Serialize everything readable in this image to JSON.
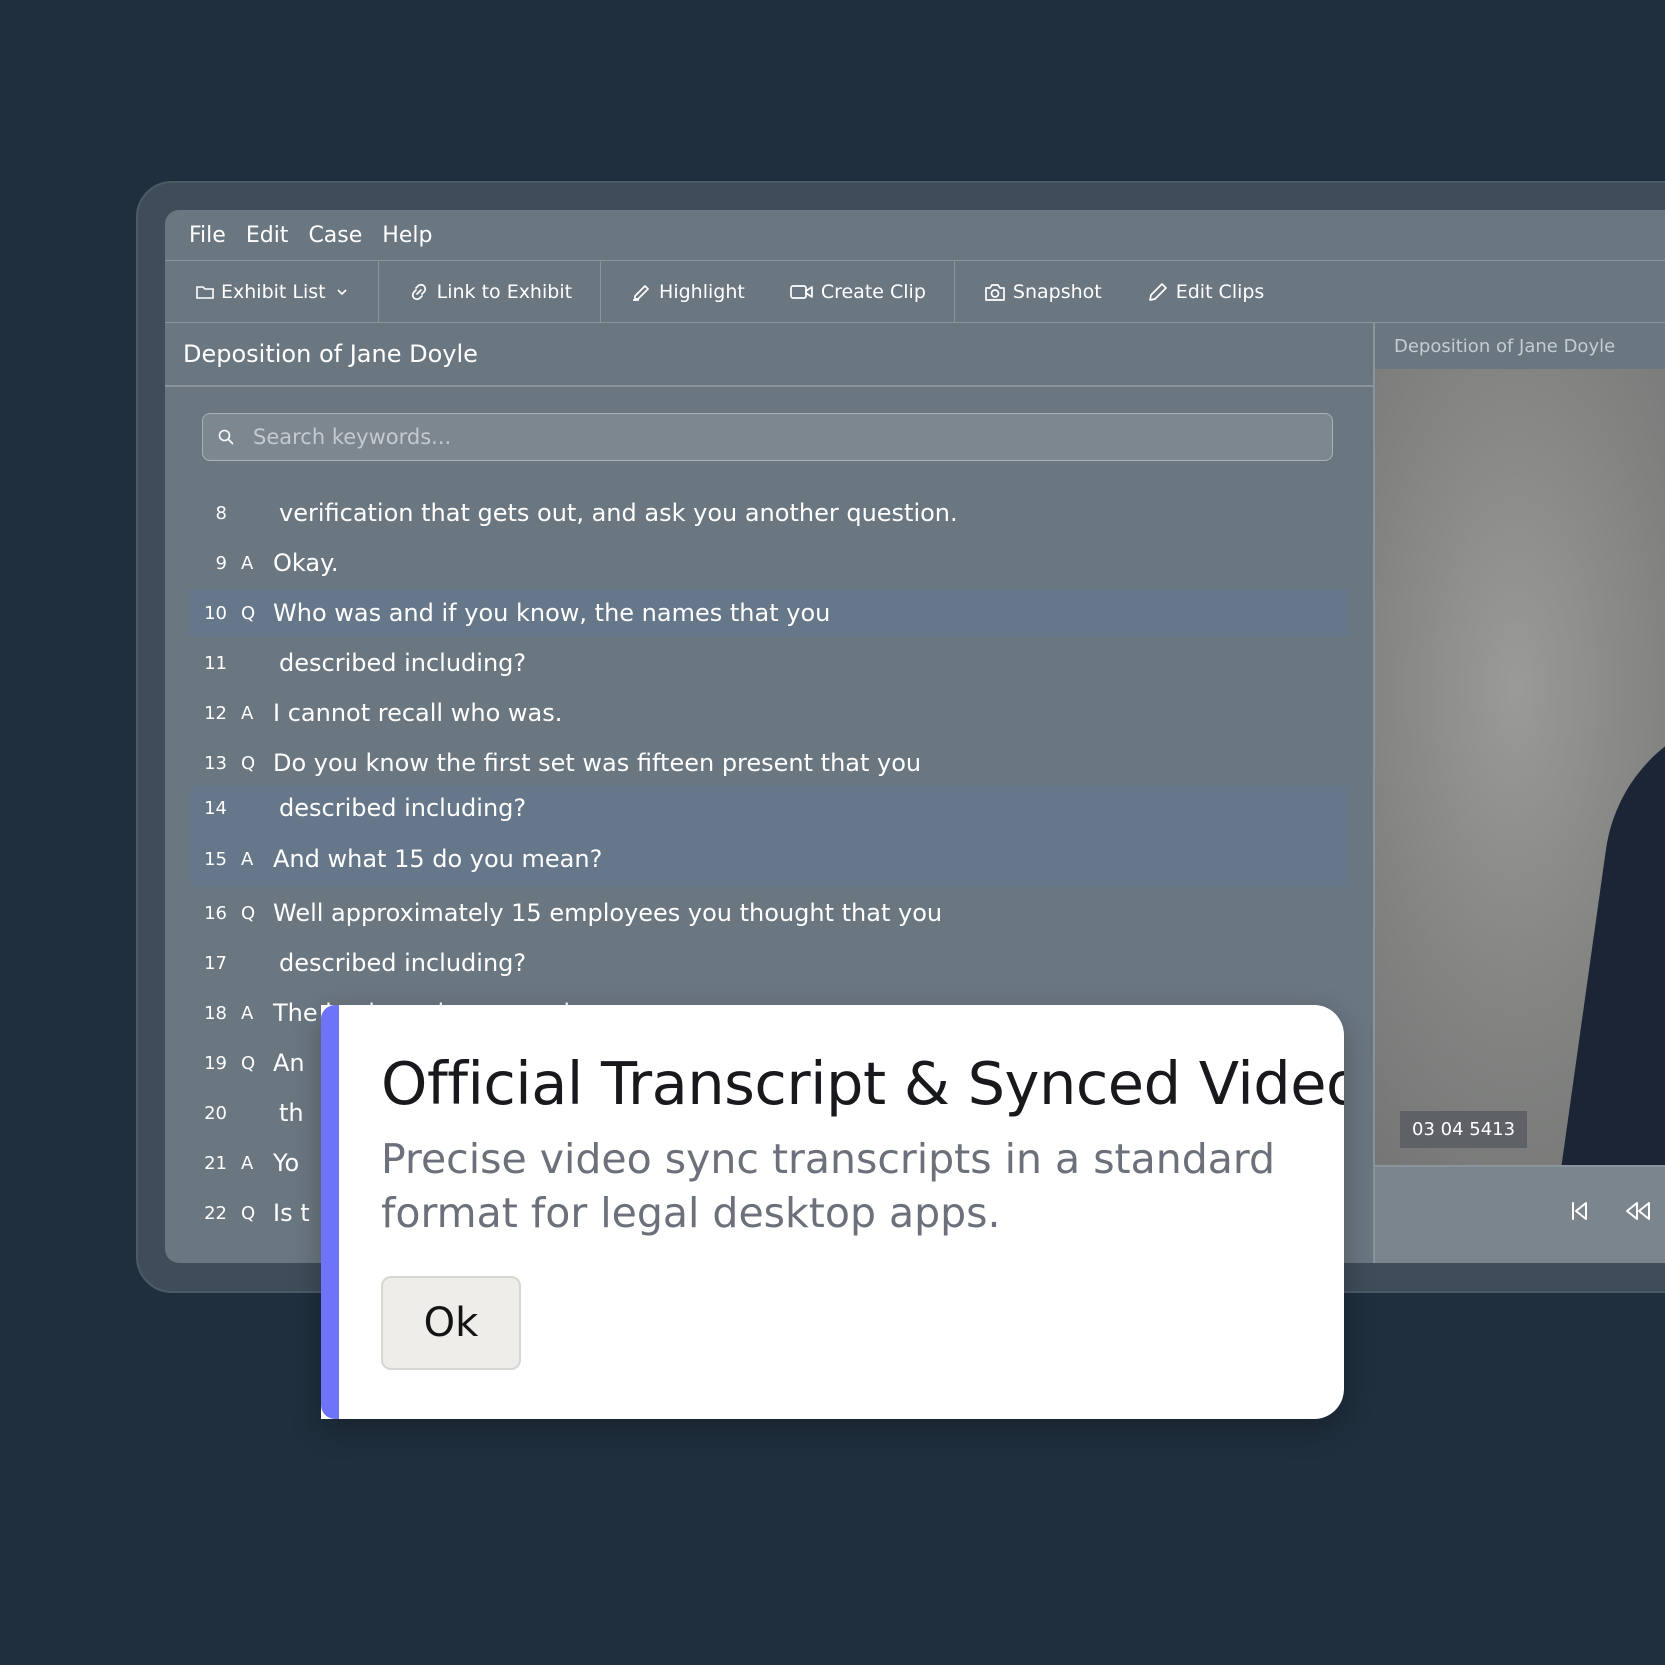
{
  "menu": [
    "File",
    "Edit",
    "Case",
    "Help"
  ],
  "toolbar": {
    "exhibit_list": "Exhibit List",
    "link_to_exhibit": "Link to Exhibit",
    "highlight": "Highlight",
    "create_clip": "Create Clip",
    "snapshot": "Snapshot",
    "edit_clips": "Edit Clips"
  },
  "transcript": {
    "title": "Deposition of Jane Doyle",
    "search_placeholder": "Search keywords...",
    "lines": [
      {
        "num": "8",
        "speaker": "",
        "text": "verification that gets out, and ask you another question.",
        "highlighted": false
      },
      {
        "num": "9",
        "speaker": "A",
        "text": "Okay.",
        "highlighted": false
      },
      {
        "num": "10",
        "speaker": "Q",
        "text": "Who was and if you know, the names that you",
        "highlighted": true
      },
      {
        "num": "11",
        "speaker": "",
        "text": "described including?",
        "highlighted": false
      },
      {
        "num": "12",
        "speaker": "A",
        "text": "I cannot recall who was.",
        "highlighted": false
      },
      {
        "num": "13",
        "speaker": "Q",
        "text": "Do you know the first set was fifteen present that you",
        "highlighted": false
      },
      {
        "num": "14",
        "speaker": "",
        "text": "described including?",
        "highlighted": true
      },
      {
        "num": "15",
        "speaker": "A",
        "text": "And what 15 do you mean?",
        "highlighted": true
      },
      {
        "num": "16",
        "speaker": "Q",
        "text": "Well approximately 15 employees you thought that you",
        "highlighted": false
      },
      {
        "num": "17",
        "speaker": "",
        "text": "described including?",
        "highlighted": false
      },
      {
        "num": "18",
        "speaker": "A",
        "text": "The business is seasonal",
        "highlighted": false
      },
      {
        "num": "19",
        "speaker": "Q",
        "text": "An",
        "highlighted": false
      },
      {
        "num": "20",
        "speaker": "",
        "text": "th",
        "highlighted": false
      },
      {
        "num": "21",
        "speaker": "A",
        "text": "Yo",
        "highlighted": false
      },
      {
        "num": "22",
        "speaker": "Q",
        "text": "Is t",
        "highlighted": false
      }
    ]
  },
  "video": {
    "title": "Deposition of Jane Doyle",
    "timecode": "03 04 5413"
  },
  "dialog": {
    "title": "Official Transcript & Synced Video",
    "body": "Precise video sync transcripts in a standard format for legal desktop apps.",
    "ok_label": "Ok",
    "accent_color": "#6e74f7"
  }
}
